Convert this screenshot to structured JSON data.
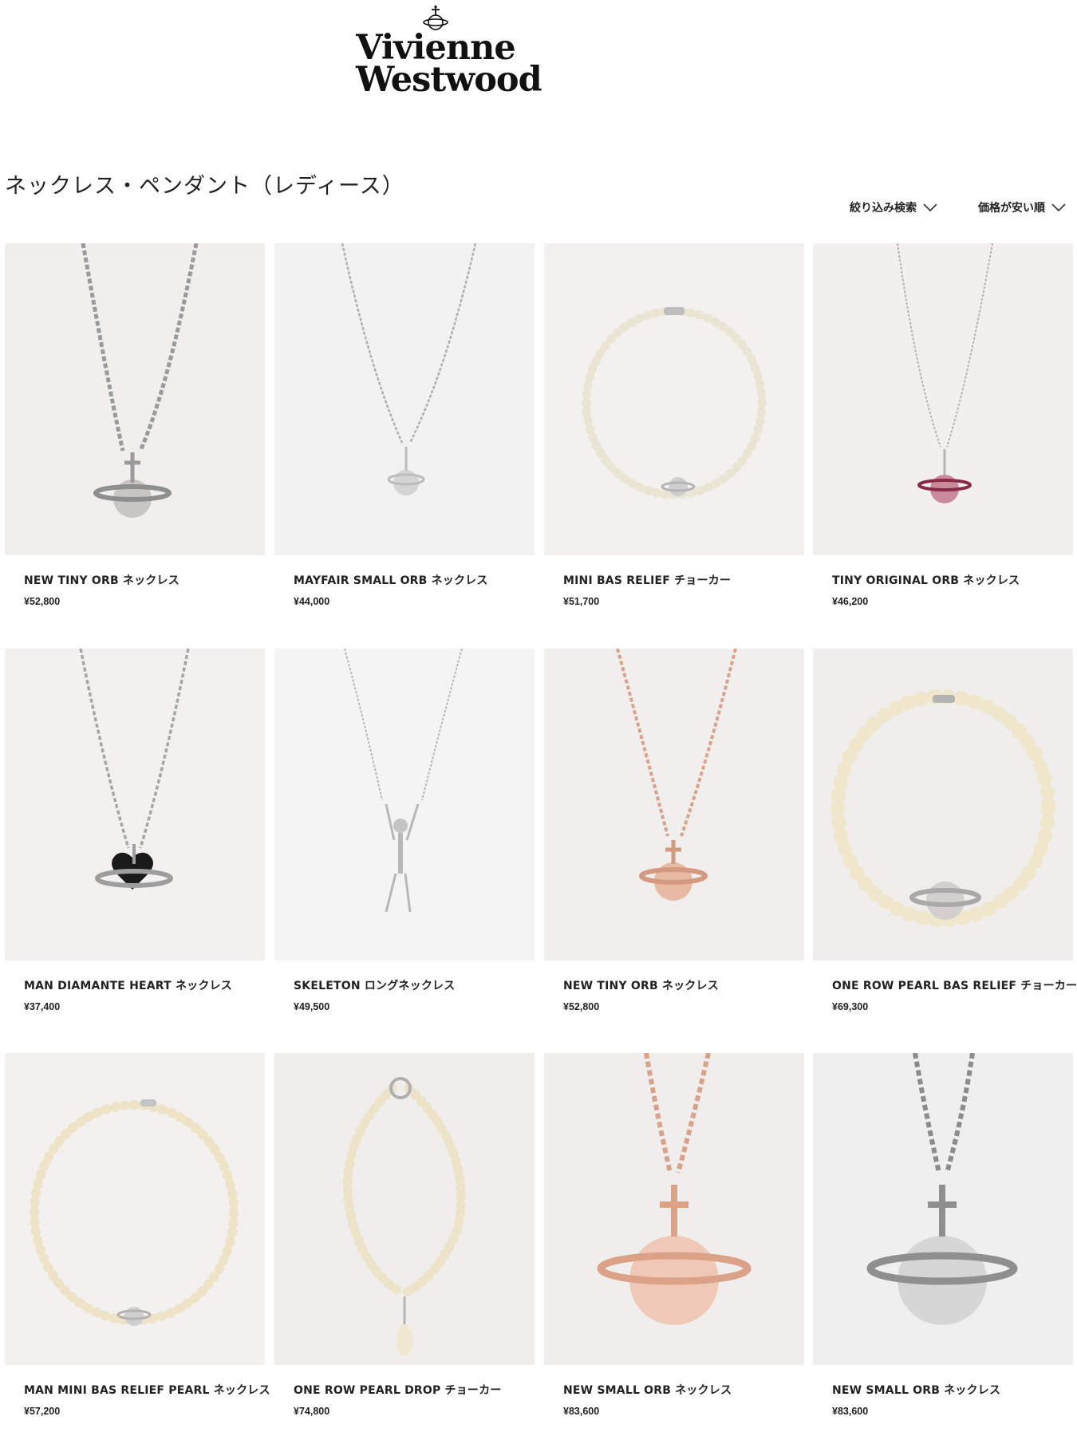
{
  "header": {
    "brand_line1": "Vivienne",
    "brand_line2": "Westwood",
    "logo_icon": "orb-logo-icon"
  },
  "page": {
    "title": "ネックレス・ペンダント（レディース）"
  },
  "controls": {
    "filter_label": "絞り込み検索",
    "sort_label": "価格が安い順",
    "icon": "chevron-down-icon"
  },
  "colors": {
    "image_bg": "#f1efed",
    "text": "#222222"
  },
  "products": [
    {
      "name": "NEW TINY ORB ネックレス",
      "price": "¥52,800",
      "style": "silver-chain-orb"
    },
    {
      "name": "MAYFAIR SMALL ORB ネックレス",
      "price": "¥44,000",
      "style": "silver-fine-chain-orb"
    },
    {
      "name": "MINI BAS RELIEF チョーカー",
      "price": "¥51,700",
      "style": "pearl-choker"
    },
    {
      "name": "TINY ORIGINAL ORB ネックレス",
      "price": "¥46,200",
      "style": "silver-pink-orb"
    },
    {
      "name": "MAN DIAMANTE HEART ネックレス",
      "price": "¥37,400",
      "style": "silver-heart"
    },
    {
      "name": "SKELETON ロングネックレス",
      "price": "¥49,500",
      "style": "skeleton"
    },
    {
      "name": "NEW TINY ORB ネックレス",
      "price": "¥52,800",
      "style": "rose-gold-orb"
    },
    {
      "name": "ONE ROW PEARL BAS RELIEF チョーカー",
      "price": "¥69,300",
      "style": "pearl-choker-large"
    },
    {
      "name": "MAN MINI BAS RELIEF PEARL ネックレス",
      "price": "¥57,200",
      "style": "pearl-necklace"
    },
    {
      "name": "ONE ROW PEARL DROP チョーカー",
      "price": "¥74,800",
      "style": "pearl-drop"
    },
    {
      "name": "NEW SMALL ORB ネックレス",
      "price": "¥83,600",
      "style": "rose-gold-large-orb"
    },
    {
      "name": "NEW SMALL ORB ネックレス",
      "price": "¥83,600",
      "style": "silver-large-orb"
    }
  ]
}
